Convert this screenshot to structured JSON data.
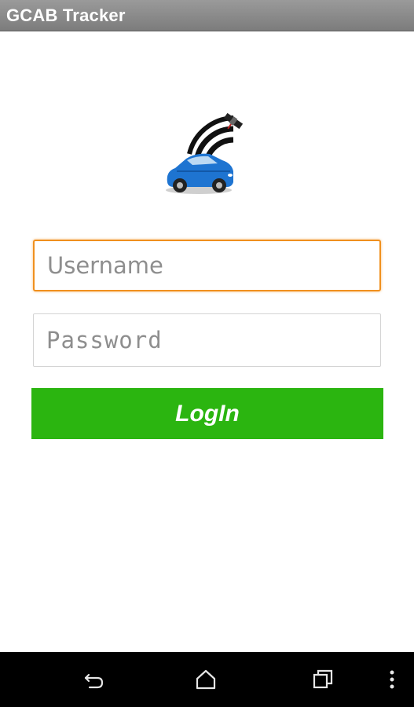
{
  "window": {
    "title": "GCAB Tracker"
  },
  "logo": {
    "icon": "car-satellite-icon",
    "colors": {
      "car": "#1e74d1",
      "signal": "#111111"
    }
  },
  "form": {
    "username_placeholder": "Username",
    "username_value": "",
    "password_placeholder": "Password",
    "password_value": "",
    "login_label": "LogIn"
  },
  "colors": {
    "titlebar": "#8a8a8a",
    "focus_border": "#f0901e",
    "login_button": "#2bb510",
    "navbar": "#000000"
  },
  "navbar": {
    "icons": [
      "back-icon",
      "home-icon",
      "recent-apps-icon",
      "overflow-menu-icon"
    ]
  }
}
